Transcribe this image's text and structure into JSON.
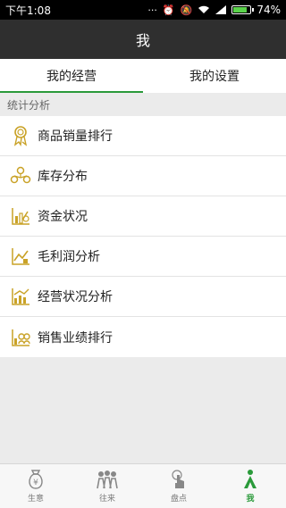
{
  "status_bar": {
    "time": "下午1:08",
    "battery": "74%",
    "battery_level": 0.74
  },
  "title_bar": {
    "title": "我"
  },
  "tabs": [
    {
      "label": "我的经营",
      "active": true
    },
    {
      "label": "我的设置",
      "active": false
    }
  ],
  "section": {
    "header": "统计分析"
  },
  "menu": {
    "items": [
      {
        "label": "商品销量排行",
        "icon": "award-ribbon-icon"
      },
      {
        "label": "库存分布",
        "icon": "inventory-distribution-icon"
      },
      {
        "label": "资金状况",
        "icon": "fund-chart-icon"
      },
      {
        "label": "毛利润分析",
        "icon": "profit-chart-icon"
      },
      {
        "label": "经营状况分析",
        "icon": "operation-chart-icon"
      },
      {
        "label": "销售业绩排行",
        "icon": "sales-ranking-icon"
      }
    ]
  },
  "bottom_nav": {
    "items": [
      {
        "label": "生意",
        "icon": "money-bag-icon",
        "active": false
      },
      {
        "label": "往来",
        "icon": "people-icon",
        "active": false
      },
      {
        "label": "盘点",
        "icon": "touch-icon",
        "active": false
      },
      {
        "label": "我",
        "icon": "person-icon",
        "active": true
      }
    ]
  },
  "colors": {
    "accent": "#2a9a3a",
    "icon_gold": "#c9a227",
    "title_bar": "#2f2f2f"
  }
}
